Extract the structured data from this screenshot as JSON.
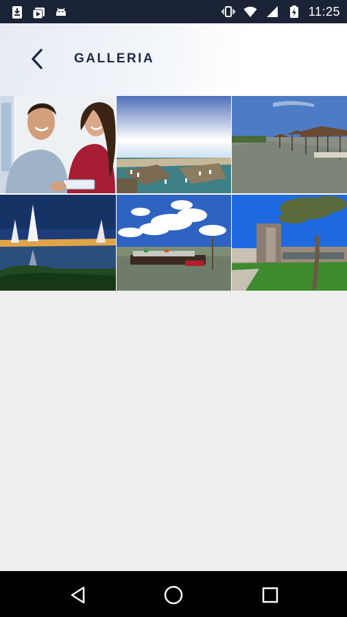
{
  "status_bar": {
    "time": "11:25",
    "left_icons": [
      "download-icon",
      "media-play-icon",
      "android-icon"
    ],
    "right_icons": [
      "vibrate-icon",
      "wifi-icon",
      "signal-icon",
      "battery-icon"
    ]
  },
  "header": {
    "title": "GALLERIA",
    "back_icon": "chevron-left-icon"
  },
  "gallery": {
    "photos": [
      {
        "subject": "couple-with-tablet"
      },
      {
        "subject": "harbor-aerial"
      },
      {
        "subject": "lagoon-fishing-huts"
      },
      {
        "subject": "sailboats-at-night"
      },
      {
        "subject": "river-boat-clouds"
      },
      {
        "subject": "building-with-tree"
      }
    ]
  },
  "nav_bar": {
    "icons": [
      "back-triangle-icon",
      "home-circle-icon",
      "recents-square-icon"
    ]
  },
  "colors": {
    "status_bar": "#1b2436",
    "title": "#1f2a44",
    "background": "#efefef",
    "nav_bar": "#000000"
  }
}
